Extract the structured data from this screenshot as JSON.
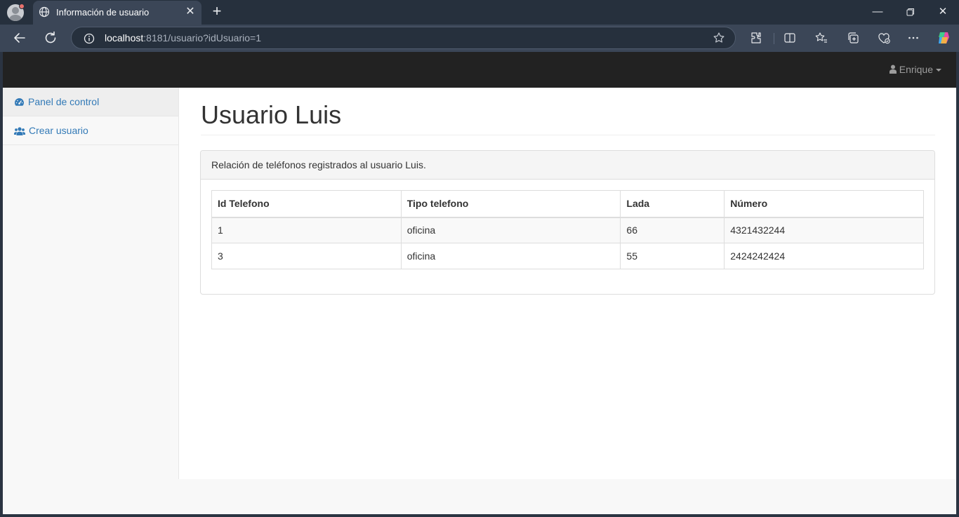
{
  "browser": {
    "tab_title": "Información de usuario",
    "url_host": "localhost",
    "url_rest": ":8181/usuario?idUsuario=1"
  },
  "navbar": {
    "user_name": "Enrique"
  },
  "sidebar": {
    "items": [
      {
        "label": "Panel de control",
        "icon": "dashboard-icon"
      },
      {
        "label": "Crear usuario",
        "icon": "users-icon"
      }
    ]
  },
  "main": {
    "title": "Usuario Luis",
    "panel_heading": "Relación de teléfonos registrados al usuario Luis.",
    "table": {
      "headers": [
        "Id Telefono",
        "Tipo telefono",
        "Lada",
        "Número"
      ],
      "rows": [
        [
          "1",
          "oficina",
          "66",
          "4321432244"
        ],
        [
          "3",
          "oficina",
          "55",
          "2424242424"
        ]
      ]
    }
  },
  "colors": {
    "link": "#337ab7",
    "navbar": "#222222",
    "chrome_tabstrip": "#26303d",
    "chrome_toolbar": "#3b4657"
  }
}
